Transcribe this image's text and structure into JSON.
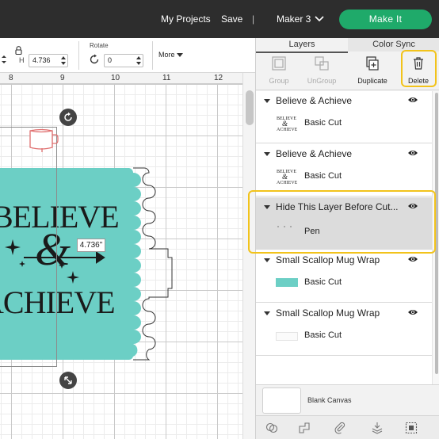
{
  "header": {
    "my_projects": "My Projects",
    "save": "Save",
    "separator": "|",
    "machine": "Maker 3",
    "make_it": "Make It",
    "colors": {
      "bar": "#2d2d2d",
      "make_it": "#1faa6a"
    }
  },
  "toolbar": {
    "h_label": "H",
    "h_value": "4.736",
    "rotate_label": "Rotate",
    "rotate_value": "0",
    "more": "More"
  },
  "canvas": {
    "ruler": [
      "8",
      "9",
      "10",
      "11",
      "12"
    ],
    "design_lines": [
      "BELIEVE",
      "&",
      "ACHIEVE"
    ],
    "dimension_label": "4.736\"",
    "colors": {
      "wrap": "#6ccfc5",
      "selection": "#8c8c8c"
    }
  },
  "panel": {
    "tabs": [
      "Layers",
      "Color Sync"
    ],
    "actions": [
      "Group",
      "UnGroup",
      "Duplicate",
      "Delete"
    ],
    "layers": [
      {
        "title": "Believe & Achieve",
        "operation": "Basic Cut",
        "thumb": "believe-achieve"
      },
      {
        "title": "Believe & Achieve",
        "operation": "Basic Cut",
        "thumb": "believe-achieve"
      },
      {
        "title": "Hide This Layer Before Cut...",
        "operation": "Pen",
        "thumb": "pen"
      },
      {
        "title": "Small Scallop Mug Wrap",
        "operation": "Basic Cut",
        "thumb": "teal-swatch"
      },
      {
        "title": "Small Scallop Mug Wrap",
        "operation": "Basic Cut",
        "thumb": "white-swatch"
      }
    ],
    "blank_canvas": "Blank Canvas",
    "colors": {
      "highlight": "#f2c31b",
      "selected_layer": "#dcdcdc"
    }
  }
}
